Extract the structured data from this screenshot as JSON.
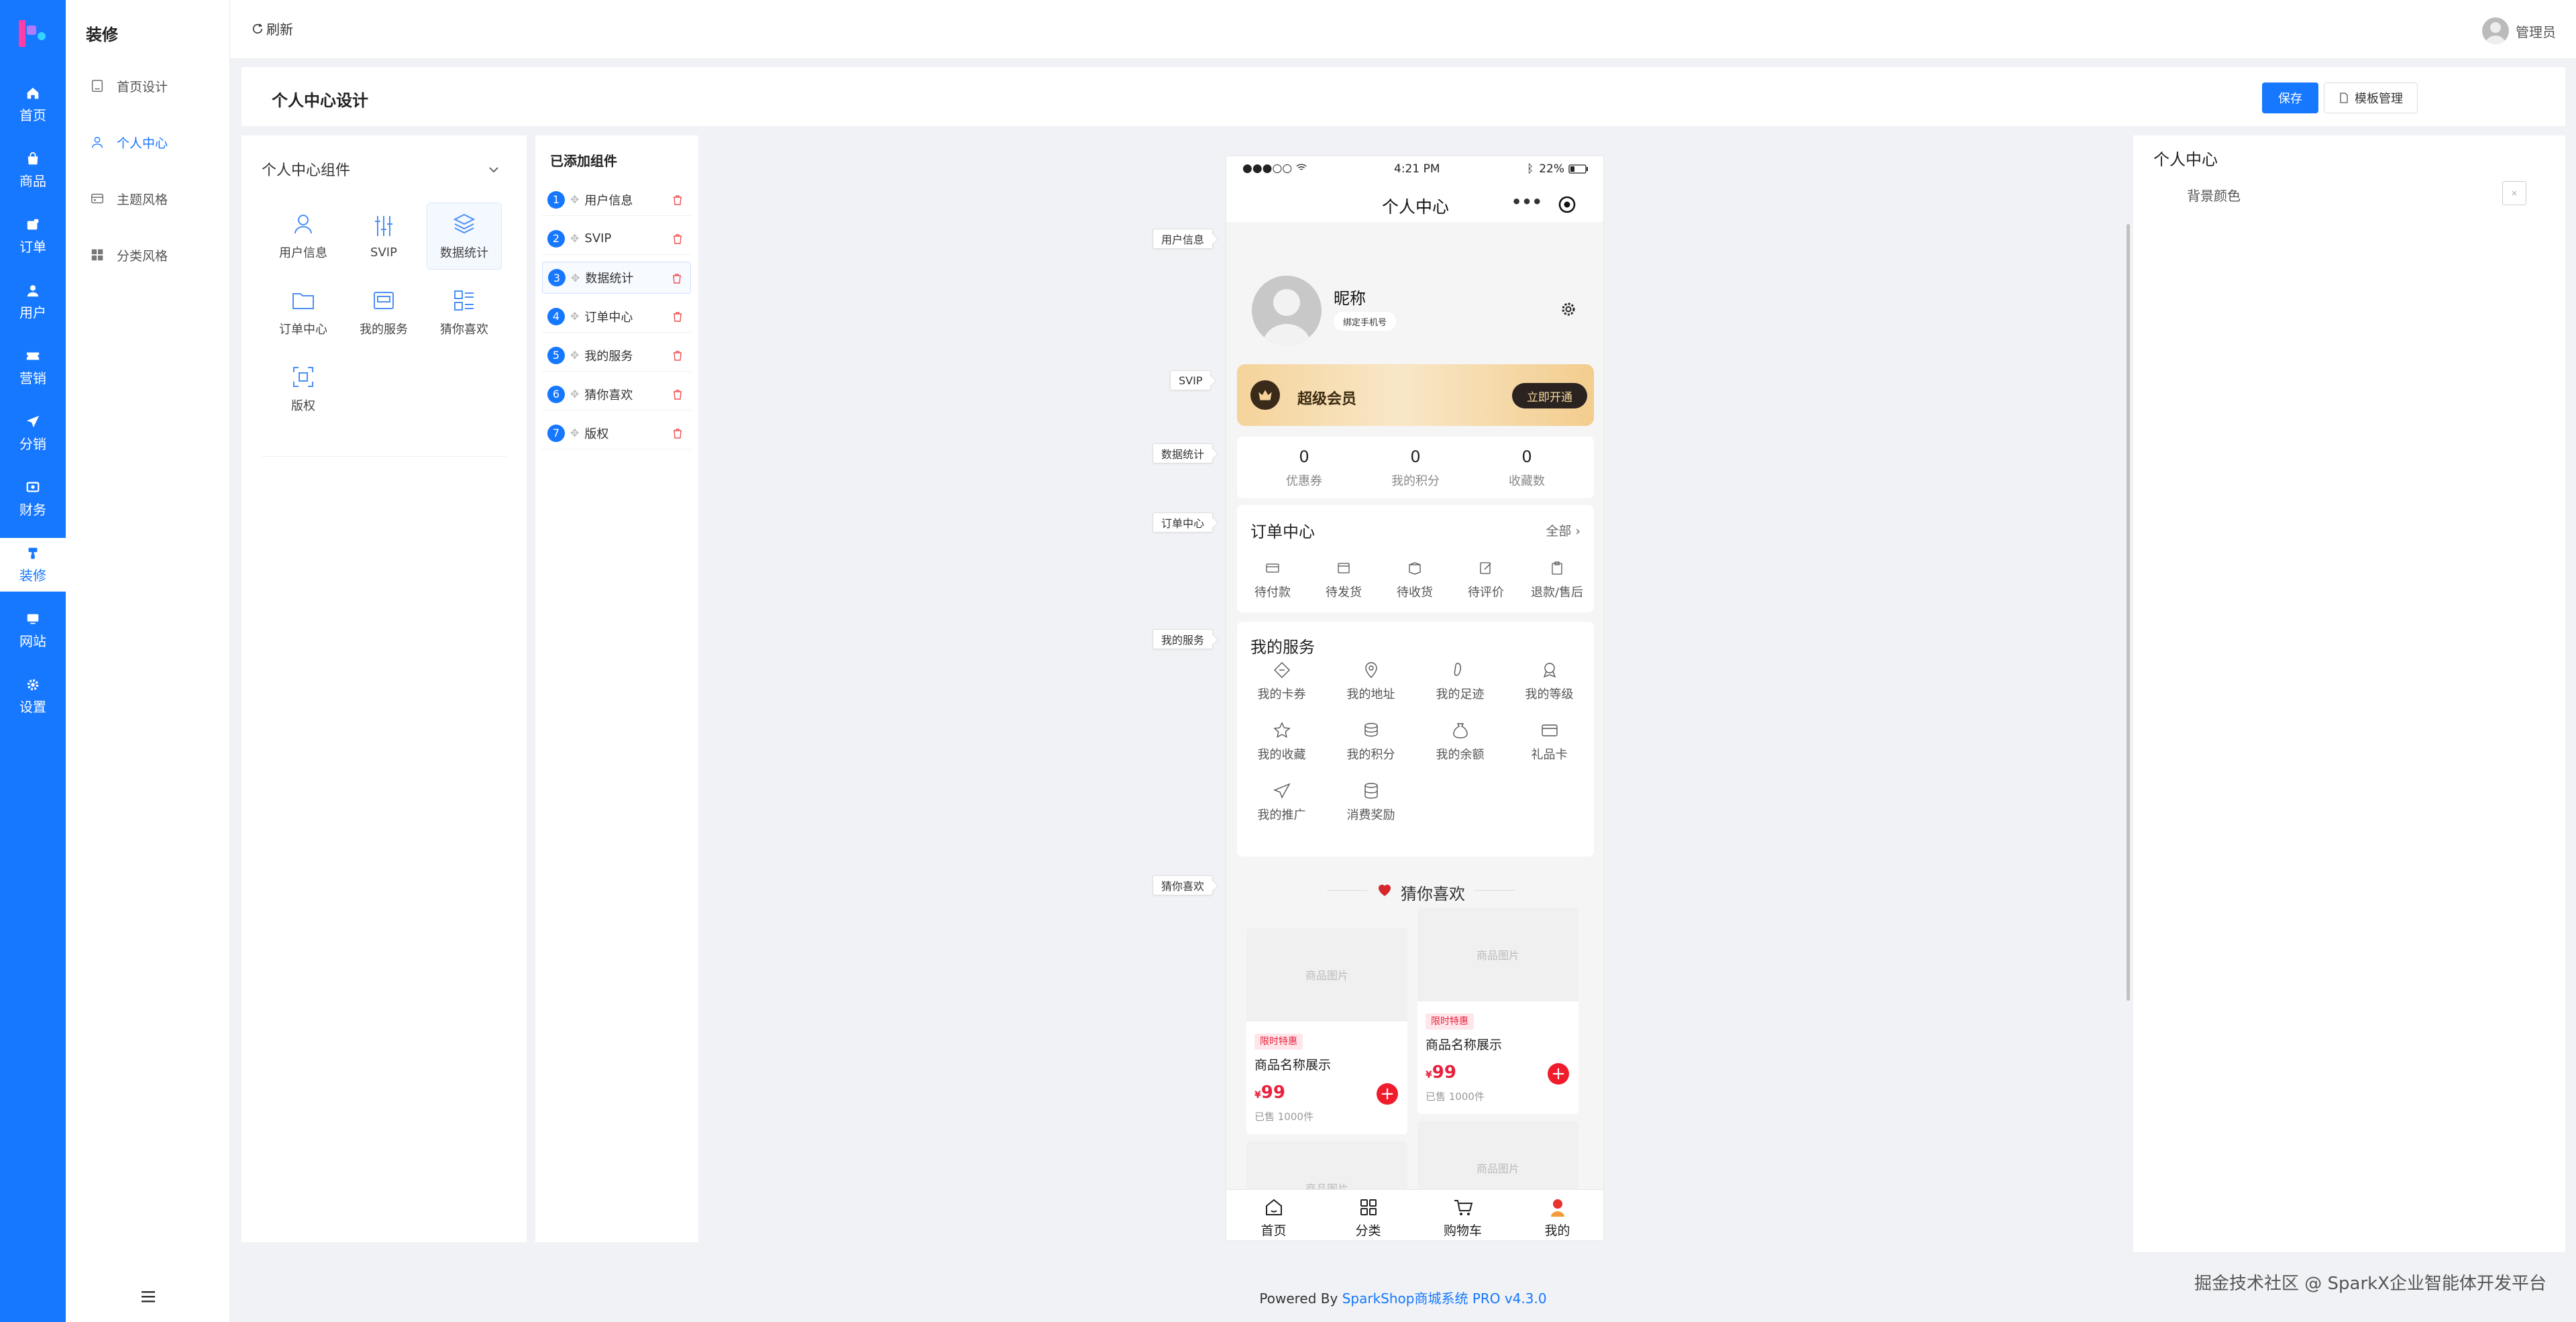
{
  "rail": {
    "items": [
      {
        "label": "首页",
        "icon": "home-icon"
      },
      {
        "label": "商品",
        "icon": "bag-icon"
      },
      {
        "label": "订单",
        "icon": "order-icon"
      },
      {
        "label": "用户",
        "icon": "user-icon"
      },
      {
        "label": "营销",
        "icon": "ticket-icon"
      },
      {
        "label": "分销",
        "icon": "send-icon"
      },
      {
        "label": "财务",
        "icon": "finance-icon"
      },
      {
        "label": "装修",
        "icon": "brush-icon"
      },
      {
        "label": "网站",
        "icon": "monitor-icon"
      },
      {
        "label": "设置",
        "icon": "gear-icon"
      }
    ],
    "active_index": 7,
    "accent": "#1677ff"
  },
  "nav2": {
    "title": "装修",
    "items": [
      {
        "label": "首页设计",
        "icon": "page-icon"
      },
      {
        "label": "个人中心",
        "icon": "user-icon"
      },
      {
        "label": "主题风格",
        "icon": "palette-icon"
      },
      {
        "label": "分类风格",
        "icon": "grid-icon"
      }
    ],
    "active_index": 1
  },
  "topbar": {
    "refresh": "刷新",
    "admin": "管理员"
  },
  "header": {
    "title": "个人中心设计",
    "save": "保存",
    "template": "模板管理"
  },
  "components": {
    "title": "个人中心组件",
    "items": [
      {
        "label": "用户信息",
        "icon": "user-icon"
      },
      {
        "label": "SVIP",
        "icon": "sliders-icon"
      },
      {
        "label": "数据统计",
        "icon": "layers-icon"
      },
      {
        "label": "订单中心",
        "icon": "folder-icon"
      },
      {
        "label": "我的服务",
        "icon": "service-icon"
      },
      {
        "label": "猜你喜欢",
        "icon": "list-icon"
      },
      {
        "label": "版权",
        "icon": "scan-icon"
      }
    ],
    "selected_index": 2
  },
  "added": {
    "title": "已添加组件",
    "items": [
      {
        "num": "1",
        "label": "用户信息"
      },
      {
        "num": "2",
        "label": "SVIP"
      },
      {
        "num": "3",
        "label": "数据统计"
      },
      {
        "num": "4",
        "label": "订单中心"
      },
      {
        "num": "5",
        "label": "我的服务"
      },
      {
        "num": "6",
        "label": "猜你喜欢"
      },
      {
        "num": "7",
        "label": "版权"
      }
    ],
    "selected_index": 2
  },
  "tags": {
    "user": "用户信息",
    "svip": "SVIP",
    "stats": "数据统计",
    "orders": "订单中心",
    "service": "我的服务",
    "guess": "猜你喜欢"
  },
  "phone": {
    "status": {
      "signal": "●●●○○",
      "time": "4:21 PM",
      "battery": "22%"
    },
    "title": "个人中心",
    "profile": {
      "nickname": "昵称",
      "bind": "绑定手机号"
    },
    "vip": {
      "title": "超级会员",
      "button": "立即开通"
    },
    "stats": [
      {
        "value": "0",
        "label": "优惠券"
      },
      {
        "value": "0",
        "label": "我的积分"
      },
      {
        "value": "0",
        "label": "收藏数"
      }
    ],
    "orders": {
      "title": "订单中心",
      "all": "全部 ›",
      "items": [
        "待付款",
        "待发货",
        "待收货",
        "待评价",
        "退款/售后"
      ]
    },
    "service": {
      "title": "我的服务",
      "items": [
        "我的卡券",
        "我的地址",
        "我的足迹",
        "我的等级",
        "我的收藏",
        "我的积分",
        "我的余额",
        "礼品卡",
        "我的推广",
        "消费奖励"
      ]
    },
    "guess": {
      "title": "猜你喜欢",
      "img": "商品图片",
      "tag": "限时特惠",
      "name": "商品名称展示",
      "currency": "¥",
      "price": "99",
      "sold": "已售 1000件"
    },
    "tabs": [
      "首页",
      "分类",
      "购物车",
      "我的"
    ]
  },
  "props": {
    "title": "个人中心",
    "bg_label": "背景颜色",
    "swatch": "×"
  },
  "footer": {
    "prefix": "Powered By ",
    "link": "SparkShop商城系统 PRO v4.3.0"
  },
  "watermark": "掘金技术社区 @ SparkX企业智能体开发平台"
}
